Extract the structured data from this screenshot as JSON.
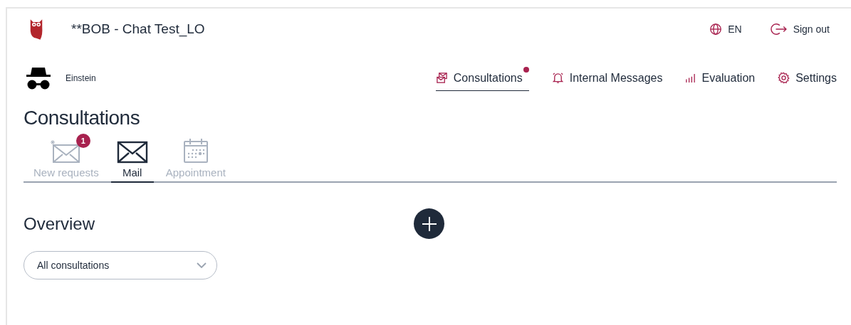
{
  "header": {
    "title": "**BOB - Chat Test_LO",
    "language": "EN",
    "sign_out": "Sign out"
  },
  "user": {
    "name": "Einstein"
  },
  "nav": [
    {
      "kind": "consultations",
      "label": "Consultations",
      "selected": true,
      "notification": true
    },
    {
      "kind": "messages",
      "label": "Internal Messages",
      "selected": false,
      "notification": false
    },
    {
      "kind": "evaluation",
      "label": "Evaluation",
      "selected": false,
      "notification": false
    },
    {
      "kind": "settings",
      "label": "Settings",
      "selected": false,
      "notification": false
    }
  ],
  "page_title": "Consultations",
  "subtabs": [
    {
      "kind": "new",
      "label": "New requests",
      "selected": false,
      "badge": "1"
    },
    {
      "kind": "mail",
      "label": "Mail",
      "selected": true
    },
    {
      "kind": "appointment",
      "label": "Appointment",
      "selected": false
    }
  ],
  "overview": {
    "title": "Overview",
    "filter": "All consultations"
  }
}
